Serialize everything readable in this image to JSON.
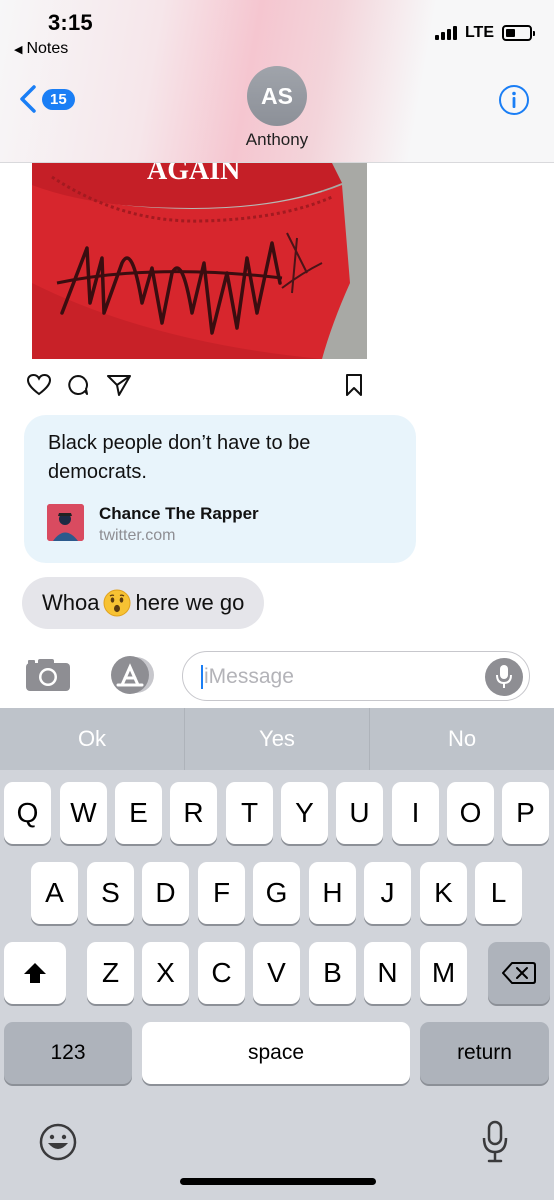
{
  "status_bar": {
    "time": "3:15",
    "back_app": "Notes",
    "network": "LTE"
  },
  "nav": {
    "unread_count": "15",
    "avatar_initials": "AS",
    "contact_name": "Anthony"
  },
  "conversation": {
    "hat_image_text": "AGAIN",
    "link_preview": {
      "text": "Black people don’t have to be democrats.",
      "title": "Chance The Rapper",
      "domain": "twitter.com"
    },
    "message": {
      "before_emoji": "Whoa",
      "after_emoji": "here we go",
      "emoji": "hushed-face"
    }
  },
  "input": {
    "placeholder": "iMessage"
  },
  "keyboard": {
    "predictions": [
      "Ok",
      "Yes",
      "No"
    ],
    "row1": [
      "Q",
      "W",
      "E",
      "R",
      "T",
      "Y",
      "U",
      "I",
      "O",
      "P"
    ],
    "row2": [
      "A",
      "S",
      "D",
      "F",
      "G",
      "H",
      "J",
      "K",
      "L"
    ],
    "row3": [
      "Z",
      "X",
      "C",
      "V",
      "B",
      "N",
      "M"
    ],
    "numbers_key": "123",
    "space_key": "space",
    "return_key": "return"
  },
  "colors": {
    "accent": "#1a7ef5",
    "incoming_bubble": "#e5e5ea",
    "link_bubble": "#e8f4fb",
    "hat_red": "#d7262d"
  }
}
